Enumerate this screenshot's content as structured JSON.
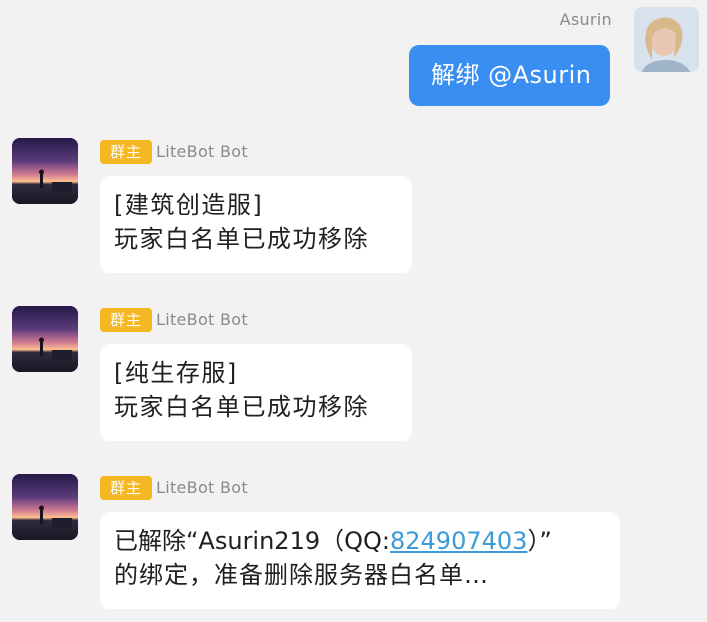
{
  "self_message": {
    "sender_name": "Asurin",
    "text": "解绑 @Asurin"
  },
  "bot_messages": [
    {
      "role_badge": "群主",
      "sender_name": "LiteBot Bot",
      "line1": "[建筑创造服]",
      "line2": "玩家白名单已成功移除"
    },
    {
      "role_badge": "群主",
      "sender_name": "LiteBot Bot",
      "line1": "[纯生存服]",
      "line2": "玩家白名单已成功移除"
    },
    {
      "role_badge": "群主",
      "sender_name": "LiteBot Bot",
      "line1_prefix": "已解除“Asurin219（QQ:",
      "line1_link": "824907403",
      "line1_suffix": "）”",
      "line2": "的绑定，准备删除服务器白名单…"
    }
  ],
  "colors": {
    "background": "#f2f2f2",
    "self_bubble": "#3a8ef2",
    "bot_bubble": "#ffffff",
    "badge": "#f6b724",
    "link": "#3a9bd8"
  }
}
